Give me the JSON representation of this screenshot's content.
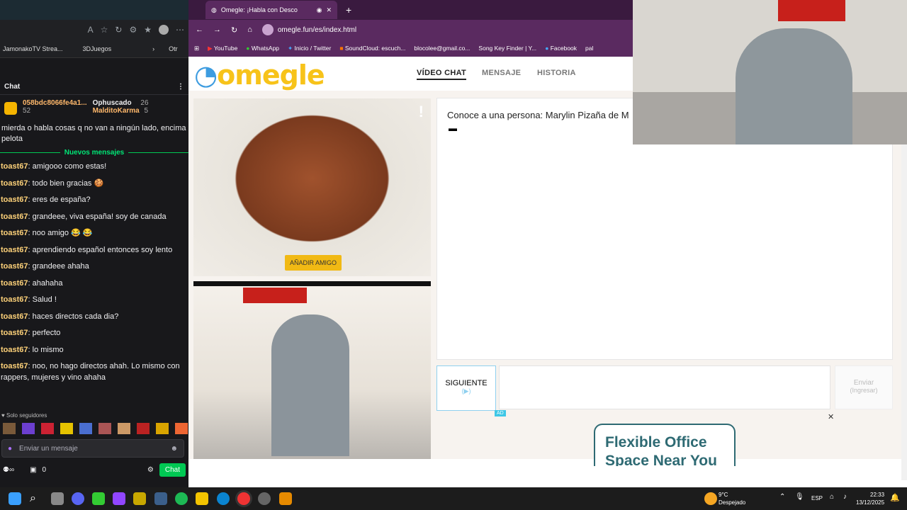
{
  "left_browser": {
    "bookmarks": [
      "JamonakoTV Strea...",
      "3DJuegos",
      "Otr"
    ],
    "chat": {
      "title": "Chat",
      "leaders": [
        {
          "name": "058bdc8066fe4a1...",
          "score": "52"
        },
        {
          "name": "Ophuscado",
          "score": "26"
        },
        {
          "name": "MalditoKarma",
          "score": "5"
        }
      ],
      "pinned_text": "mierda o habla cosas q no van a ningún lado, encima pelota",
      "new_messages_label": "Nuevos mensajes",
      "messages": [
        {
          "user": "toast67",
          "text": "amigooo como estas!"
        },
        {
          "user": "toast67",
          "text": "todo bien gracias 🍪"
        },
        {
          "user": "toast67",
          "text": "eres de españa?"
        },
        {
          "user": "toast67",
          "text": "grandeee, viva españa! soy de canada"
        },
        {
          "user": "toast67",
          "text": "noo amigo 😂 😂"
        },
        {
          "user": "toast67",
          "text": "aprendiendo español entonces soy lento"
        },
        {
          "user": "toast67",
          "text": "grandeee ahaha"
        },
        {
          "user": "toast67",
          "text": "ahahaha"
        },
        {
          "user": "toast67",
          "text": "Salud !"
        },
        {
          "user": "toast67",
          "text": "haces directos cada dia?"
        },
        {
          "user": "toast67",
          "text": "perfecto"
        },
        {
          "user": "toast67",
          "text": "lo mismo"
        },
        {
          "user": "toast67",
          "text": "noo, no hago directos ahah. Lo mismo con rappers, mujeres y vino ahaha"
        }
      ],
      "followers_only": "Solo seguidores",
      "input_placeholder": "Enviar un mensaje",
      "points": "0",
      "chat_button": "Chat"
    }
  },
  "omegle_browser": {
    "tab_title": "Omegle: ¡Habla con Desco",
    "url": "omegle.fun/es/index.html",
    "bookmarks": [
      "YouTube",
      "WhatsApp",
      "Inicio / Twitter",
      "SoundCloud: escuch...",
      "blocolee@gmail.co...",
      "Song Key Finder | Y...",
      "Facebook",
      "pal"
    ],
    "logo": "omegle",
    "nav": [
      "VÍDEO CHAT",
      "MENSAJE",
      "HISTORIA"
    ],
    "add_friend": "AÑADIR AMIGO",
    "meet_text": "Conoce a una persona: Marylin Pizaña de M",
    "next_button": "SIGUIENTE",
    "next_sub": "(▶)",
    "send_button": "Enviar",
    "send_sub": "(Ingresar)",
    "ad_badge": "AD",
    "ad_text": "Flexible Office Space Near You"
  },
  "taskbar": {
    "weather_temp": "9°C",
    "weather_desc": "Despejado",
    "lang": "ESP",
    "time": "22:33",
    "date": "13/12/2025"
  },
  "colors": {
    "omegle_purple": "#5a2a60",
    "omegle_yellow": "#f7c31a",
    "twitch_green": "#00c853"
  }
}
